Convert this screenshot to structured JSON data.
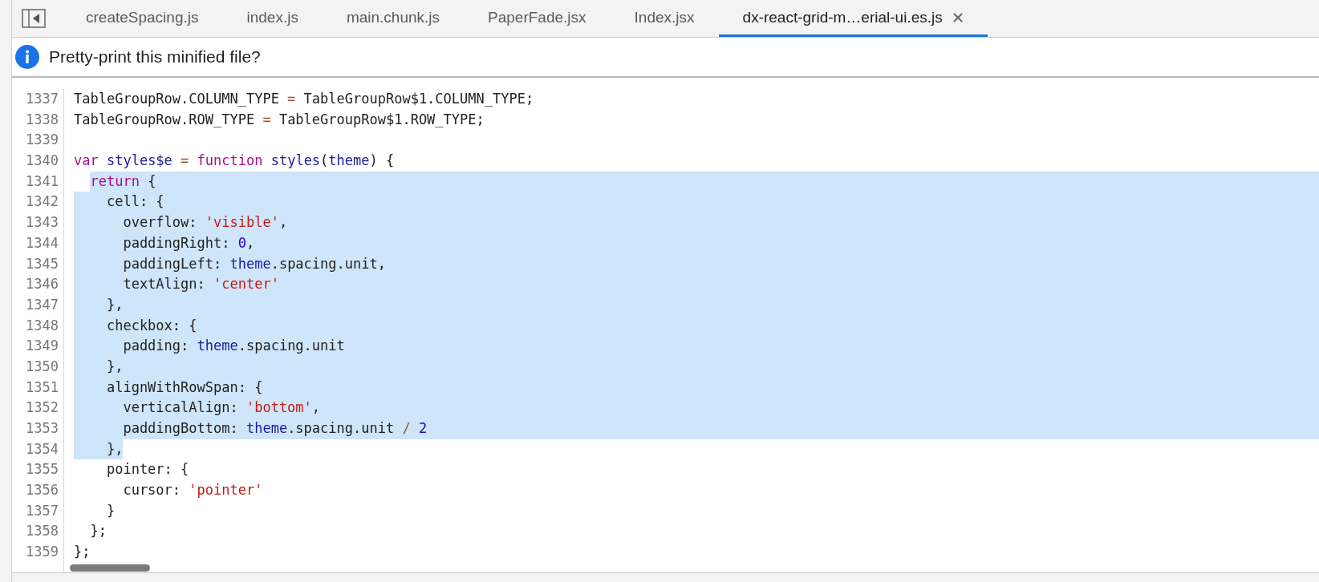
{
  "tabs": [
    {
      "label": "createSpacing.js",
      "selected": false
    },
    {
      "label": "index.js",
      "selected": false
    },
    {
      "label": "main.chunk.js",
      "selected": false
    },
    {
      "label": "PaperFade.jsx",
      "selected": false
    },
    {
      "label": "Index.jsx",
      "selected": false
    },
    {
      "label": "dx-react-grid-m…erial-ui.es.js",
      "selected": true
    }
  ],
  "infobar": {
    "message": "Pretty-print this minified file?"
  },
  "editor": {
    "lines": [
      {
        "number": "1337",
        "selected": false,
        "tokens": [
          {
            "kind": "plain",
            "text": "TableGroupRow.COLUMN_TYPE "
          },
          {
            "kind": "op",
            "text": "= "
          },
          {
            "kind": "plain",
            "text": "TableGroupRow$1.COLUMN_TYPE;"
          }
        ]
      },
      {
        "number": "1338",
        "selected": false,
        "tokens": [
          {
            "kind": "plain",
            "text": "TableGroupRow.ROW_TYPE "
          },
          {
            "kind": "op",
            "text": "= "
          },
          {
            "kind": "plain",
            "text": "TableGroupRow$1.ROW_TYPE;"
          }
        ]
      },
      {
        "number": "1339",
        "selected": false
      },
      {
        "number": "1340",
        "selected": false,
        "tokens": [
          {
            "kind": "keyword",
            "text": "var "
          },
          {
            "kind": "def",
            "text": "styles$e "
          },
          {
            "kind": "op",
            "text": "= "
          },
          {
            "kind": "keyword",
            "text": "function "
          },
          {
            "kind": "def",
            "text": "styles"
          },
          {
            "kind": "plain",
            "text": "("
          },
          {
            "kind": "def",
            "text": "theme"
          },
          {
            "kind": "plain",
            "text": ") {"
          }
        ]
      },
      {
        "number": "1341",
        "selected": true,
        "tokens": [
          {
            "kind": "keyword",
            "text": "  return"
          },
          {
            "kind": "plain",
            "text": " {"
          }
        ]
      },
      {
        "number": "1342",
        "selected": true,
        "tokens": [
          {
            "kind": "plain",
            "text": "    cell: {"
          }
        ]
      },
      {
        "number": "1343",
        "selected": true,
        "tokens": [
          {
            "kind": "plain",
            "text": "      overflow: "
          },
          {
            "kind": "string",
            "text": "'visible'"
          },
          {
            "kind": "plain",
            "text": ","
          }
        ]
      },
      {
        "number": "1344",
        "selected": true,
        "tokens": [
          {
            "kind": "plain",
            "text": "      paddingRight: "
          },
          {
            "kind": "number",
            "text": "0"
          },
          {
            "kind": "plain",
            "text": ","
          }
        ]
      },
      {
        "number": "1345",
        "selected": true,
        "tokens": [
          {
            "kind": "plain",
            "text": "      paddingLeft: "
          },
          {
            "kind": "def",
            "text": "theme"
          },
          {
            "kind": "plain",
            "text": ".spacing.unit,"
          }
        ]
      },
      {
        "number": "1346",
        "selected": true,
        "tokens": [
          {
            "kind": "plain",
            "text": "      textAlign: "
          },
          {
            "kind": "string",
            "text": "'center'"
          }
        ]
      },
      {
        "number": "1347",
        "selected": true,
        "tokens": [
          {
            "kind": "plain",
            "text": "    },"
          }
        ]
      },
      {
        "number": "1348",
        "selected": true,
        "tokens": [
          {
            "kind": "plain",
            "text": "    checkbox: {"
          }
        ]
      },
      {
        "number": "1349",
        "selected": true,
        "tokens": [
          {
            "kind": "plain",
            "text": "      padding: "
          },
          {
            "kind": "def",
            "text": "theme"
          },
          {
            "kind": "plain",
            "text": ".spacing.unit"
          }
        ]
      },
      {
        "number": "1350",
        "selected": true,
        "tokens": [
          {
            "kind": "plain",
            "text": "    },"
          }
        ]
      },
      {
        "number": "1351",
        "selected": true,
        "tokens": [
          {
            "kind": "plain",
            "text": "    alignWithRowSpan: {"
          }
        ]
      },
      {
        "number": "1352",
        "selected": true,
        "tokens": [
          {
            "kind": "plain",
            "text": "      verticalAlign: "
          },
          {
            "kind": "string",
            "text": "'bottom'"
          },
          {
            "kind": "plain",
            "text": ","
          }
        ]
      },
      {
        "number": "1353",
        "selected": true,
        "tokens": [
          {
            "kind": "plain",
            "text": "      paddingBottom: "
          },
          {
            "kind": "def",
            "text": "theme"
          },
          {
            "kind": "plain",
            "text": ".spacing.unit "
          },
          {
            "kind": "op",
            "text": "/ "
          },
          {
            "kind": "number",
            "text": "2"
          }
        ]
      },
      {
        "number": "1354",
        "selected": true,
        "tokens": [
          {
            "kind": "plain",
            "text": "    },"
          }
        ]
      },
      {
        "number": "1355",
        "selected": false,
        "tokens": [
          {
            "kind": "plain",
            "text": "    pointer: {"
          }
        ]
      },
      {
        "number": "1356",
        "selected": false,
        "tokens": [
          {
            "kind": "plain",
            "text": "      cursor: "
          },
          {
            "kind": "string",
            "text": "'pointer'"
          }
        ]
      },
      {
        "number": "1357",
        "selected": false,
        "tokens": [
          {
            "kind": "plain",
            "text": "    }"
          }
        ]
      },
      {
        "number": "1358",
        "selected": false,
        "tokens": [
          {
            "kind": "plain",
            "text": "  };"
          }
        ]
      },
      {
        "number": "1359",
        "selected": false,
        "tokens": [
          {
            "kind": "plain",
            "text": "};"
          }
        ]
      }
    ]
  }
}
